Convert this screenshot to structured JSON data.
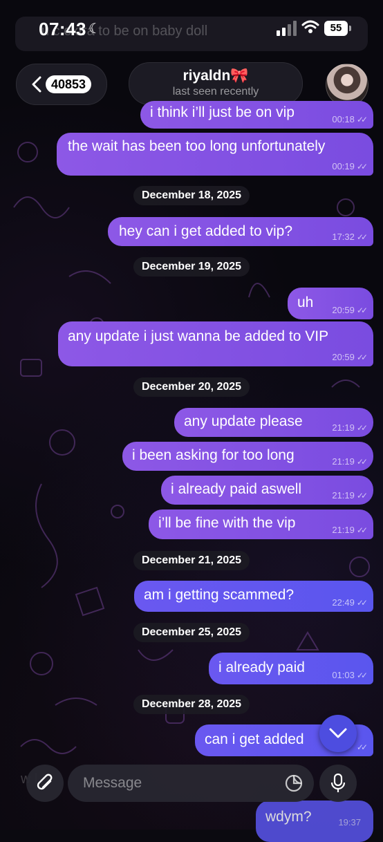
{
  "status_bar": {
    "time": "07:43",
    "battery": "55",
    "background_text": "u c    extra to be on baby doll"
  },
  "header": {
    "back_count": "40853",
    "contact_name": "riyaldn",
    "contact_emoji": "🎀",
    "contact_status": "last seen recently"
  },
  "messages": [
    {
      "text": "i think i’ll just be on vip",
      "time": "00:18"
    },
    {
      "text": "the wait has been too long unfortunately",
      "time": "00:19"
    },
    {
      "date": "December 18, 2025"
    },
    {
      "text": "hey can i get added to vip?",
      "time": "17:32"
    },
    {
      "date": "December 19, 2025"
    },
    {
      "text": "uh",
      "time": "20:59"
    },
    {
      "text": "any update i just wanna be added to VIP",
      "time": "20:59"
    },
    {
      "date": "December 20, 2025"
    },
    {
      "text": "any update please",
      "time": "21:19"
    },
    {
      "text": "i been asking for too long",
      "time": "21:19"
    },
    {
      "text": "i already paid aswell",
      "time": "21:19"
    },
    {
      "text": "i’ll be fine with the vip",
      "time": "21:19"
    },
    {
      "date": "December 21, 2025"
    },
    {
      "text": "am i getting scammed?",
      "time": "22:49"
    },
    {
      "date": "December 25, 2025"
    },
    {
      "text": "i already paid",
      "time": "01:03"
    },
    {
      "date": "December 28, 2025"
    },
    {
      "text": "can i get added",
      "time": ""
    },
    {
      "text": "wdym?",
      "time": "19:37"
    }
  ],
  "composer": {
    "placeholder": "Message",
    "behind_text": "w   l"
  },
  "icons": {
    "back": "chevron-left-icon",
    "scroll_down": "chevron-down-icon",
    "attach": "paperclip-icon",
    "sticker": "sticker-icon",
    "mic": "microphone-icon"
  },
  "colors": {
    "bubble_purple": "#8d58e6",
    "bubble_blue": "#5a56ee",
    "background": "#09080e"
  }
}
